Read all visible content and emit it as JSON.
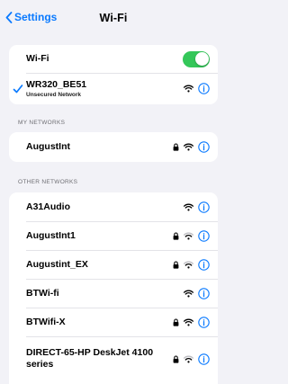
{
  "nav": {
    "back_label": "Settings",
    "title": "Wi-Fi"
  },
  "wifi_toggle": {
    "label": "Wi-Fi",
    "on": true,
    "color_on": "#34c759"
  },
  "connected": {
    "name": "WR320_BE51",
    "subtitle": "Unsecured Network",
    "icons": [
      "checkmark-icon",
      "wifi-signal-icon",
      "info-icon"
    ]
  },
  "my_networks": {
    "header": "MY NETWORKS",
    "items": [
      {
        "name": "AugustInt",
        "locked": true
      }
    ]
  },
  "other_networks": {
    "header": "OTHER NETWORKS",
    "items": [
      {
        "name": "A31Audio",
        "locked": false
      },
      {
        "name": "AugustInt1",
        "locked": true
      },
      {
        "name": "Augustint_EX",
        "locked": true
      },
      {
        "name": "BTWi-fi",
        "locked": false
      },
      {
        "name": "BTWifi-X",
        "locked": true
      },
      {
        "name": "DIRECT-65-HP DeskJet 4100 series",
        "locked": true
      }
    ]
  },
  "colors": {
    "accent": "#0a7aff",
    "background": "#f2f2f7"
  }
}
